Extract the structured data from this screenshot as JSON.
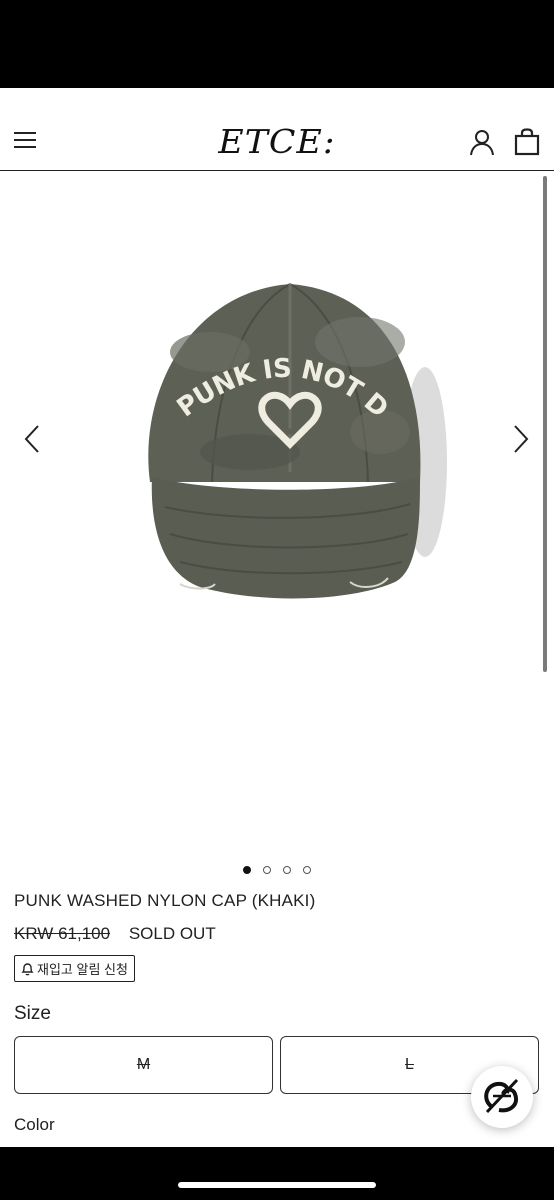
{
  "header": {
    "logo": "ETCE:",
    "icons": [
      "menu-icon",
      "user-icon",
      "shopping-bag-icon"
    ]
  },
  "gallery": {
    "image_text": "PUNK IS NOT DEAD",
    "total_images": 4,
    "active_index": 0
  },
  "product": {
    "title": "PUNK WASHED NYLON CAP (KHAKI)",
    "old_price": "KRW 61,100",
    "status": "SOLD OUT",
    "restock_label": "재입고 알림 신청"
  },
  "size": {
    "label": "Size",
    "options": [
      {
        "label": "M",
        "sold_out": true
      },
      {
        "label": "L",
        "sold_out": true
      }
    ]
  },
  "color": {
    "label": "Color"
  },
  "colors": {
    "background": "#ffffff",
    "text": "#222222",
    "bars": "#000000",
    "cap": "#5d6055"
  }
}
